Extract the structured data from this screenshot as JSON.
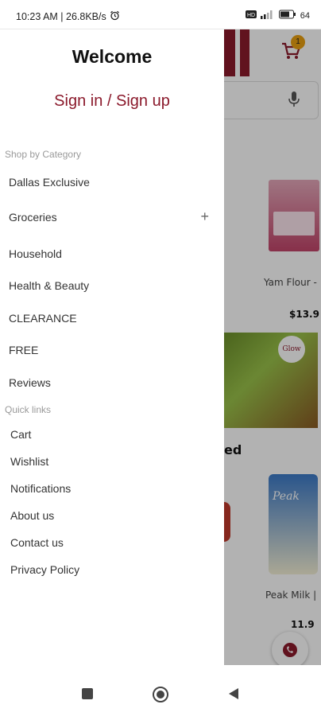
{
  "status_bar": {
    "left_text": "10:23 AM | 26.8KB/s",
    "battery": "64"
  },
  "app_background": {
    "cart_count": "1",
    "product": {
      "name": "Yam Flour -",
      "price": "$13.9"
    },
    "banner_logo": "Glow",
    "section_title": "ed",
    "milk_brand": "Peak",
    "milk_product": {
      "name": "Peak Milk |",
      "price": "11.9"
    },
    "colors": {
      "brand": "#8b1a2c",
      "badge": "#e8a010"
    }
  },
  "drawer": {
    "title": "Welcome",
    "signin_label": "Sign in / Sign up",
    "category_header": "Shop by Category",
    "categories": [
      {
        "label": "Dallas Exclusive"
      },
      {
        "label": "Groceries",
        "expand_icon": "+"
      },
      {
        "label": "Household"
      },
      {
        "label": "Health & Beauty"
      },
      {
        "label": "CLEARANCE"
      },
      {
        "label": "FREE"
      },
      {
        "label": "Reviews"
      }
    ],
    "quick_links_header": "Quick links",
    "quick_links": [
      {
        "label": "Cart"
      },
      {
        "label": "Wishlist"
      },
      {
        "label": "Notifications"
      },
      {
        "label": "About us"
      },
      {
        "label": "Contact us"
      },
      {
        "label": "Privacy Policy"
      }
    ]
  },
  "nav_bar": {
    "icons": [
      "recent-apps-icon",
      "home-icon",
      "back-icon"
    ]
  }
}
